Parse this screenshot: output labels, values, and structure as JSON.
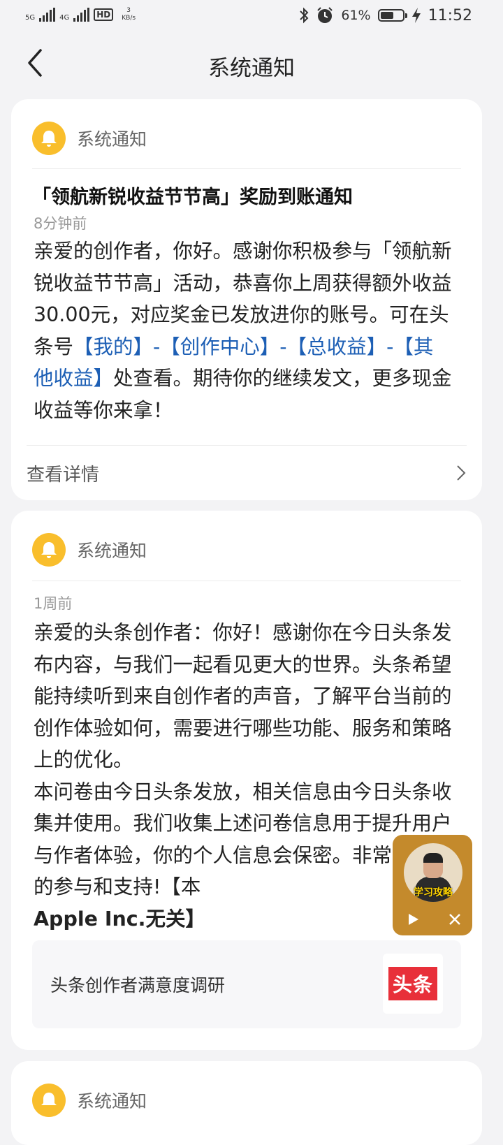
{
  "status_bar": {
    "network1": "5G",
    "network2": "4G",
    "hd": "HD",
    "speed_value": "3",
    "speed_unit": "KB/s",
    "battery_percent": "61%",
    "battery_level": 0.61,
    "time": "11:52"
  },
  "header": {
    "title": "系统通知"
  },
  "notifications": [
    {
      "source": "系统通知",
      "title": "「领航新锐收益节节高」奖励到账通知",
      "time": "8分钟前",
      "body_prefix": "亲爱的创作者，你好。感谢你积极参与「领航新锐收益节节高」活动，恭喜你上周获得额外收益30.00元，对应奖金已发放进你的账号。可在头条号",
      "body_link": "【我的】-【创作中心】-【总收益】-【其他收益】",
      "body_suffix": "处查看。期待你的继续发文，更多现金收益等你来拿！",
      "detail_label": "查看详情"
    },
    {
      "source": "系统通知",
      "time": "1周前",
      "body_p1": "亲爱的头条创作者：你好！感谢你在今日头条发布内容，与我们一起看见更大的世界。头条希望能持续听到来自创作者的声音，了解平台当前的创作体验如何，需要进行哪些功能、服务和策略上的优化。",
      "body_p2": "本问卷由今日头条发放，相关信息由今日头条收集并使用。我们收集上述问卷信息用于提升用户与作者体验，你的个人信息会保密。非常感谢你的参与和支持!【本",
      "body_p3": "Apple Inc.无关】",
      "survey_title": "头条创作者满意度调研",
      "survey_logo_text": "头条"
    },
    {
      "source": "系统通知"
    }
  ],
  "floating_video": {
    "caption": "学习攻略"
  },
  "colors": {
    "accent_link": "#1d5fb5",
    "bell_yellow": "#f9be2c",
    "logo_red": "#e8303a"
  }
}
